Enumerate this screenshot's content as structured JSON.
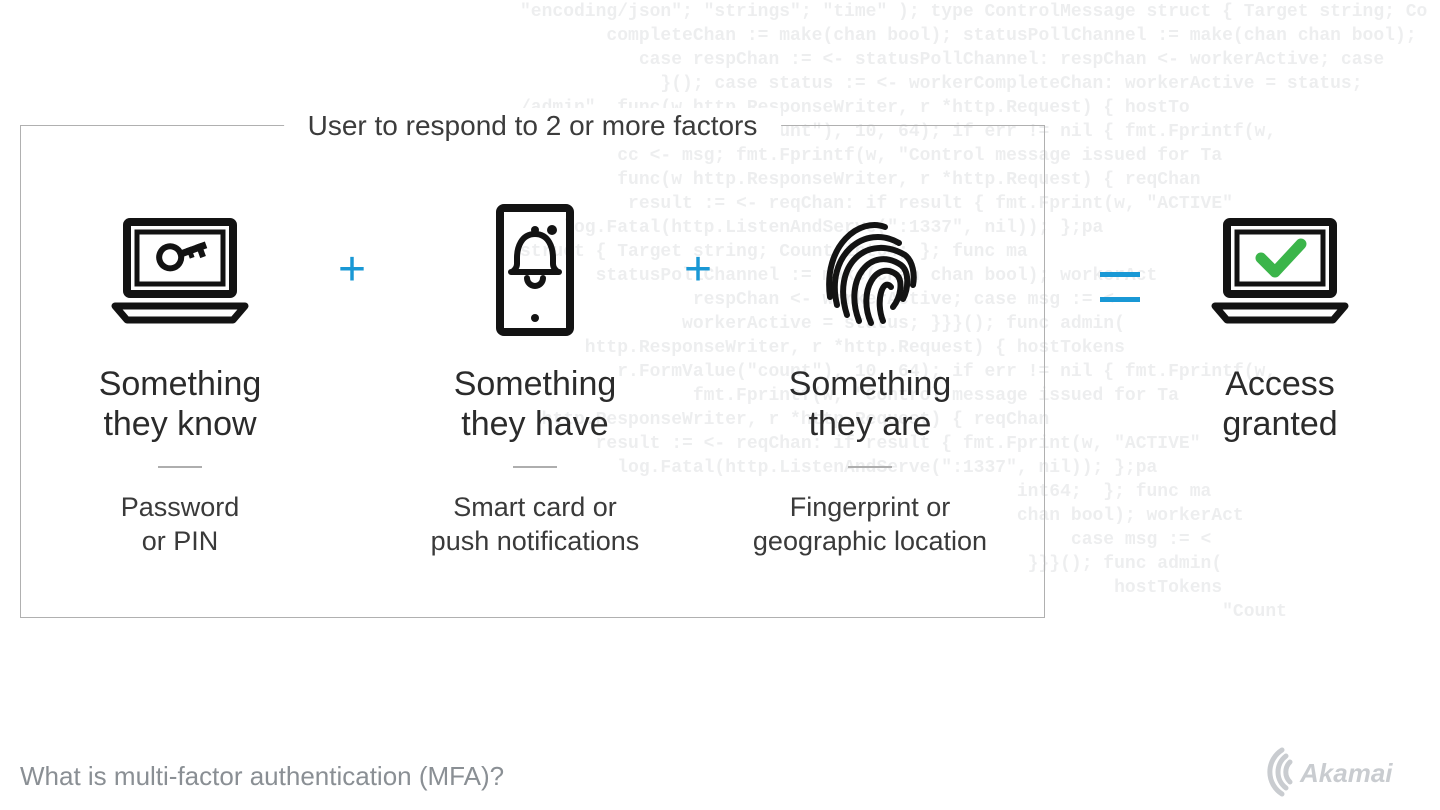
{
  "frame": {
    "title": "User to respond to 2 or more factors"
  },
  "operators": {
    "plus1": "+",
    "plus2": "+",
    "equals": "="
  },
  "factors": {
    "know": {
      "icon": "laptop-key-icon",
      "title_l1": "Something",
      "title_l2": "they know",
      "sub_l1": "Password",
      "sub_l2": "or PIN"
    },
    "have": {
      "icon": "phone-bell-icon",
      "title_l1": "Something",
      "title_l2": "they have",
      "sub_l1": "Smart card or",
      "sub_l2": "push notifications"
    },
    "are": {
      "icon": "fingerprint-icon",
      "title_l1": "Something",
      "title_l2": "they are",
      "sub_l1": "Fingerprint or",
      "sub_l2": "geographic location"
    }
  },
  "result": {
    "icon": "laptop-check-icon",
    "title_l1": "Access",
    "title_l2": "granted"
  },
  "footer": {
    "caption": "What is multi-factor authentication (MFA)?"
  },
  "brand": {
    "name": "Akamai"
  },
  "colors": {
    "operator_blue": "#1998d5",
    "check_green": "#3bb54a",
    "text_dark": "#2b2b2b",
    "border_gray": "#b0b0b0"
  },
  "bg_code": "\"encoding/json\"; \"strings\"; \"time\" ); type ControlMessage struct { Target string; Co\n        completeChan := make(chan bool); statusPollChannel := make(chan chan bool);\n           case respChan := <- statusPollChannel: respChan <- workerActive; case\n             }(); case status := <- workerCompleteChan: workerActive = status;\n/admin\", func(w http.ResponseWriter, r *http.Request) { hostTo\nParseInt(r.FormValue(\"count\"), 10, 64); if err != nil { fmt.Fprintf(w,\n         cc <- msg; fmt.Fprintf(w, \"Control message issued for Ta\n         func(w http.ResponseWriter, r *http.Request) { reqChan\n          result := <- reqChan: if result { fmt.Fprint(w, \"ACTIVE\"\n    log.Fatal(http.ListenAndServe(\":1337\", nil)); };pa\nstruct { Target string; Count int64; }; func ma\n       statusPollChannel := make(chan chan bool); workerAct\n                respChan <- workerActive; case msg := <\n               workerActive = status; }}}(); func admin(\n      http.ResponseWriter, r *http.Request) { hostTokens\n         r.FormValue(\"count\"), 10, 64); if err != nil { fmt.Fprintf(w,\n                fmt.Fprintf(w, \"Control message issued for Ta\n  http.ResponseWriter, r *http.Request) { reqChan\n       result := <- reqChan: if result { fmt.Fprint(w, \"ACTIVE\"\n         log.Fatal(http.ListenAndServe(\":1337\", nil)); };pa\n                                              int64;  }; func ma\n                                              chan bool); workerAct\n                                                   case msg := <\n                                               }}}(); func admin(\n                                                       hostTokens\n                                                                 \"Count"
}
